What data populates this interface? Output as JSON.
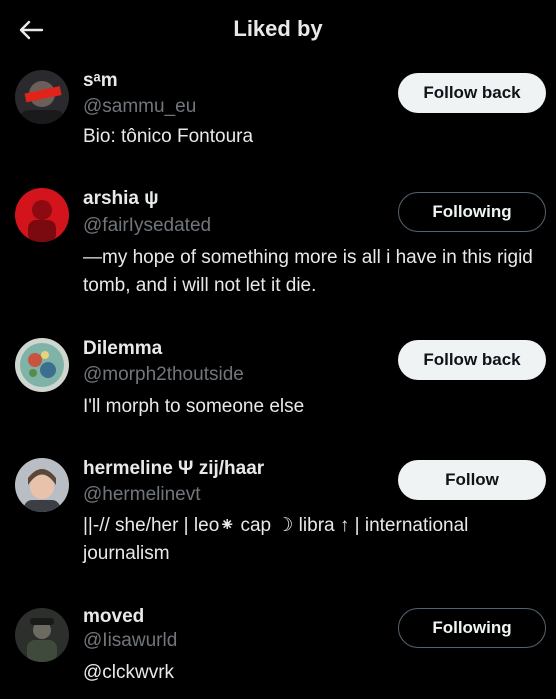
{
  "header": {
    "title": "Liked by",
    "back_icon": "arrow-left-icon"
  },
  "colors": {
    "background": "#000000",
    "primary_text": "#e7e9ea",
    "secondary_text": "#71767b",
    "light_button": "#eff3f4",
    "outline_border": "#536471"
  },
  "users": [
    {
      "name": "sᵃm",
      "handle": "@sammu_eu",
      "bio": "Bio: tônico Fontoura",
      "button": "Follow back"
    },
    {
      "name": "arshia ψ",
      "handle": "@fairIysedated",
      "bio": "—my hope of something more is all i have in this rigid tomb, and i will not let it die.",
      "button": "Following"
    },
    {
      "name": "Dilemma",
      "handle": "@morph2thoutside",
      "bio": "I'll morph to someone else",
      "button": "Follow back"
    },
    {
      "name": "hermeline Ψ zij/haar",
      "handle": "@hermelinevt",
      "bio": "||-// she/her | leo⁕ cap ☽ libra ↑ | international journalism",
      "button": "Follow"
    },
    {
      "name": "moved",
      "handle": "@Iisawurld",
      "bio": "@clckwvrk",
      "button": "Following"
    }
  ]
}
